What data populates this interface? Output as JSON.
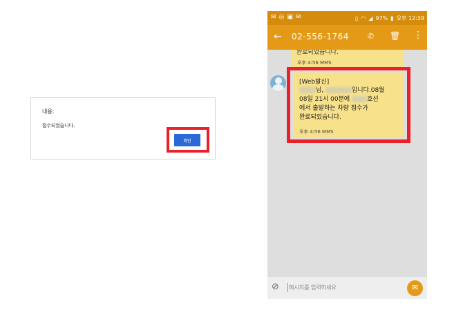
{
  "dialog": {
    "title": "내용:",
    "message": "접수되었습니다.",
    "confirm_label": "확인"
  },
  "phone": {
    "status": {
      "signal_percent": "97%",
      "time": "오후 12:39"
    },
    "appbar": {
      "back_icon": "arrow-back-icon",
      "phone_number": "02-556-1764"
    },
    "messages": [
      {
        "partial_text": "완료되었습니다.",
        "time": "오후 4:56 MMS"
      },
      {
        "line1": "[Web발신]",
        "line2_suffix": "님,",
        "line2_end": "입니다.08월",
        "line3_start": "08일 21시 00분에",
        "line3_end": "호선",
        "line4": "에서 출발하는 차량 접수가",
        "line5": "완료되었습니다.",
        "time": "오후 4:56 MMS"
      }
    ],
    "input": {
      "placeholder": "메시지를 입력하세요"
    }
  },
  "colors": {
    "accent": "#e59a17",
    "statusbar": "#d58b0c",
    "bubble": "#f7e18a",
    "highlight": "#e8212a",
    "button": "#2a6ad8"
  }
}
